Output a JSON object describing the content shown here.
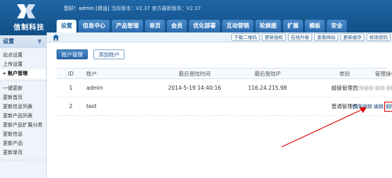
{
  "brand": {
    "logo_text": "信制科技"
  },
  "top": {
    "greeting": "您好！admin",
    "logout": "[退出]",
    "current_version": "当前版本：V2.37",
    "official_version": "官方最新版本：V2.37"
  },
  "nav": {
    "tabs": [
      {
        "label": "设置"
      },
      {
        "label": "信息中心"
      },
      {
        "label": "产品管理"
      },
      {
        "label": "单页"
      },
      {
        "label": "会员"
      },
      {
        "label": "优化部署"
      },
      {
        "label": "互动营销"
      },
      {
        "label": "轮换图"
      },
      {
        "label": "扩展"
      },
      {
        "label": "模板"
      },
      {
        "label": "安全"
      }
    ]
  },
  "toolbar": {
    "items": [
      {
        "label": "下载二维码"
      },
      {
        "label": "更新授权"
      },
      {
        "label": "在线升级"
      },
      {
        "label": "查看网站"
      },
      {
        "label": "更新缓存"
      },
      {
        "label": "修改密码"
      }
    ]
  },
  "sidebar": {
    "title": "设置",
    "group1": [
      "站点设置",
      "上传设置",
      "账户管理"
    ],
    "group2": [
      "一键更新",
      "更新首页",
      "更新信息列表",
      "更新产品列表",
      "更新产品扩展分类",
      "更新信息",
      "更新产品",
      "更新单页"
    ]
  },
  "main": {
    "btn_account": "账户管理",
    "btn_add": "添加账户",
    "headers": {
      "id": "ID",
      "account": "账户",
      "last_time": "最后登陆时间",
      "last_ip": "最后登陆IP",
      "type": "类别",
      "ops": "管理操作"
    },
    "rows": [
      {
        "id": "1",
        "account": "admin",
        "last_time": "2014-5-19 14:40:16",
        "last_ip": "116.24.215.98",
        "type": "超级管理员",
        "op_perm": "权限编辑",
        "op_edit": "编辑",
        "op_delete": "删除"
      },
      {
        "id": "2",
        "account": "test",
        "last_time": "",
        "last_ip": "",
        "type": "普通管理员",
        "op_perm": "权限编辑",
        "op_edit": "编辑",
        "op_delete": "删除"
      }
    ]
  },
  "colors": {
    "accent": "#1f66a6",
    "highlight": "#e00000"
  }
}
